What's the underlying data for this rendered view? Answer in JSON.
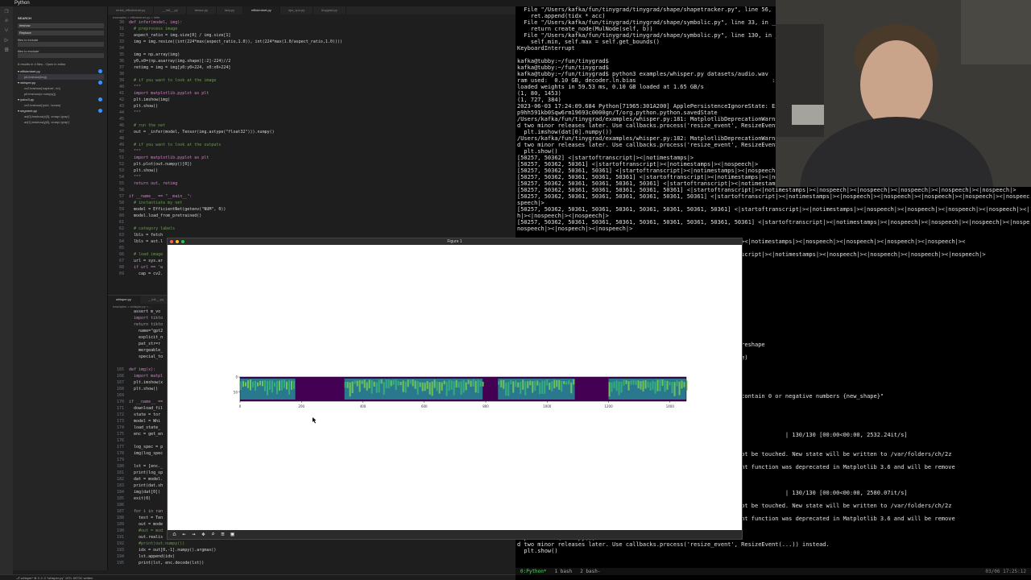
{
  "menubar": {
    "app": "Python"
  },
  "vscode": {
    "sidebar": {
      "title": "SEARCH",
      "search_value": "imshow",
      "replace_placeholder": "Replace",
      "include_label": "files to include",
      "exclude_label": "files to exclude",
      "results_summary": "8 results in 4 files - Open in editor",
      "files": [
        {
          "name": "efficientnet.py",
          "matches": [
            "plt.imshow(img)"
          ]
        },
        {
          "name": "whisper.py",
          "matches": [
            "cv2.imshow('capture', im)",
            "plt.imshow(x.numpy())"
          ]
        },
        {
          "name": "yolov3.py",
          "matches": [
            "cv2.imshow('yolo', boxes)"
          ]
        },
        {
          "name": "segment.py",
          "matches": [
            "ax[0].imshow(x[0], cmap='gray')",
            "ax[1].imshow(y[0], cmap='gray')"
          ]
        }
      ]
    },
    "tabs": [
      "mnist_efficientnet.py",
      "__init__.py",
      "tensor.py",
      "lazy.py",
      "efficientnet.py",
      "ops_cpu.py",
      "tinygrad.py"
    ],
    "active_tab": "efficientnet.py",
    "breadcrumb": "examples > efficientnet.py > infer",
    "code_top": [
      {
        "ln": "30",
        "t": "def infer(model, img):"
      },
      {
        "ln": "31",
        "t": "  # preprocess image"
      },
      {
        "ln": "32",
        "t": "  aspect_ratio = img.size[0] / img.size[1]"
      },
      {
        "ln": "33",
        "t": "  img = img.resize((int(224*max(aspect_ratio,1.0)), int(224*max(1.0/aspect_ratio,1.0))))"
      },
      {
        "ln": "34",
        "t": ""
      },
      {
        "ln": "35",
        "t": "  img = np.array(img)"
      },
      {
        "ln": "36",
        "t": "  y0,x0=(np.asarray(img.shape)[:2]-224)//2"
      },
      {
        "ln": "37",
        "t": "  retimg = img = img[y0:y0+224, x0:x0+224]"
      },
      {
        "ln": "38",
        "t": ""
      },
      {
        "ln": "39",
        "t": "  # if you want to look at the image"
      },
      {
        "ln": "40",
        "t": "  \"\"\""
      },
      {
        "ln": "41",
        "t": "  import matplotlib.pyplot as plt"
      },
      {
        "ln": "42",
        "t": "  plt.imshow(img)"
      },
      {
        "ln": "43",
        "t": "  plt.show()"
      },
      {
        "ln": "44",
        "t": "  \"\"\""
      },
      {
        "ln": "45",
        "t": ""
      },
      {
        "ln": "46",
        "t": "  # run the net"
      },
      {
        "ln": "47",
        "t": "  out = _infer(model, Tensor(img.astype(\"float32\"))).numpy()"
      },
      {
        "ln": "48",
        "t": ""
      },
      {
        "ln": "49",
        "t": "  # if you want to look at the outputs"
      },
      {
        "ln": "50",
        "t": "  \"\"\""
      },
      {
        "ln": "51",
        "t": "  import matplotlib.pyplot as plt"
      },
      {
        "ln": "52",
        "t": "  plt.plot(out.numpy()[0])"
      },
      {
        "ln": "53",
        "t": "  plt.show()"
      },
      {
        "ln": "54",
        "t": "  \"\"\""
      },
      {
        "ln": "55",
        "t": "  return out, retimg"
      },
      {
        "ln": "56",
        "t": ""
      },
      {
        "ln": "57",
        "t": "if __name__ == \"__main__\":"
      },
      {
        "ln": "58",
        "t": "  # instantiate my net"
      },
      {
        "ln": "59",
        "t": "  model = EfficientNet(getenv(\"NUM\", 0))"
      },
      {
        "ln": "60",
        "t": "  model.load_from_pretrained()"
      },
      {
        "ln": "61",
        "t": ""
      },
      {
        "ln": "62",
        "t": "  # category labels"
      },
      {
        "ln": "63",
        "t": "  lbls = fetch"
      },
      {
        "ln": "64",
        "t": "  lbls = ast.l"
      },
      {
        "ln": "65",
        "t": ""
      },
      {
        "ln": "66",
        "t": "  # load image"
      },
      {
        "ln": "67",
        "t": "  url = sys.ar"
      },
      {
        "ln": "68",
        "t": "  if url == 'w"
      },
      {
        "ln": "69",
        "t": "    cap = cv2."
      }
    ],
    "pane2_tabs": [
      "whisper.py",
      "__init__.py"
    ],
    "pane2_breadcrumb": "examples > whisper.py > ...",
    "code_bottom": [
      {
        "ln": "",
        "t": "  assert m_vo"
      },
      {
        "ln": "",
        "t": "  import tikto"
      },
      {
        "ln": "",
        "t": "  return tikto"
      },
      {
        "ln": "",
        "t": "    name=\"gpt2"
      },
      {
        "ln": "",
        "t": "    explicit_n"
      },
      {
        "ln": "",
        "t": "    pat_str=r"
      },
      {
        "ln": "",
        "t": "    mergeable_"
      },
      {
        "ln": "",
        "t": "    special_to"
      },
      {
        "ln": "",
        "t": ""
      },
      {
        "ln": "165",
        "t": "def img(x):"
      },
      {
        "ln": "166",
        "t": "  import matpl"
      },
      {
        "ln": "167",
        "t": "  plt.imshow(x"
      },
      {
        "ln": "168",
        "t": "  plt.show()"
      },
      {
        "ln": "169",
        "t": ""
      },
      {
        "ln": "170",
        "t": "if __name__ =="
      },
      {
        "ln": "171",
        "t": "  download_fil"
      },
      {
        "ln": "172",
        "t": "  state = tor"
      },
      {
        "ln": "173",
        "t": "  model = Whi"
      },
      {
        "ln": "174",
        "t": "  load_state_"
      },
      {
        "ln": "175",
        "t": "  enc = get_en"
      },
      {
        "ln": "176",
        "t": ""
      },
      {
        "ln": "177",
        "t": "  log_spec = p"
      },
      {
        "ln": "178",
        "t": "  img(log_spec"
      },
      {
        "ln": "179",
        "t": ""
      },
      {
        "ln": "180",
        "t": "  lst = [enc._"
      },
      {
        "ln": "181",
        "t": "  print(log_sp"
      },
      {
        "ln": "182",
        "t": "  dat = model."
      },
      {
        "ln": "183",
        "t": "  print(dat.sh"
      },
      {
        "ln": "184",
        "t": "  img(dat[0])"
      },
      {
        "ln": "185",
        "t": "  exit(0)"
      },
      {
        "ln": "186",
        "t": ""
      },
      {
        "ln": "187",
        "t": "  for i in ran"
      },
      {
        "ln": "188",
        "t": "    test = Ten"
      },
      {
        "ln": "189",
        "t": "    out = mode"
      },
      {
        "ln": "190",
        "t": "    #out = mod"
      },
      {
        "ln": "191",
        "t": "    out.realis"
      },
      {
        "ln": "192",
        "t": "    #print(out.numpy())"
      },
      {
        "ln": "193",
        "t": "    idx = out[0,-1].numpy().argmax()"
      },
      {
        "ln": "194",
        "t": "    lst.append(idx)"
      },
      {
        "ln": "195",
        "t": "    print(lst, enc.decode(lst))"
      }
    ],
    "status": "⎇ whisper*   ⊗ 0 ⚠ 0   \"whisper.py\" 197L 6973C written"
  },
  "terminal": {
    "lines": [
      "  File \"/Users/kafka/fun/tinygrad/tinygrad/shape/shapetracker.py\", line 56, in i",
      "    ret.append(tidx * acc)",
      "  File \"/Users/kafka/fun/tinygrad/tinygrad/shape/symbolic.py\", line 33, in __mul_",
      "    return create_node(MulNode(self, b))",
      "  File \"/Users/kafka/fun/tinygrad/tinygrad/shape/symbolic.py\", line 130, in __init",
      "    self.min, self.max = self.get_bounds()",
      "KeyboardInterrupt",
      "",
      "kafka@tubby:~/fun/tinygrad$",
      "kafka@tubby:~/fun/tinygrad$",
      "kafka@tubby:~/fun/tinygrad$ python3 examples/whisper.py datasets/audio.wav",
      "ram used:  0.10 GB, decoder.ln.bias                                        : 100%|",
      "loaded weights in 59.53 ms, 0.10 GB loaded at 1.65 GB/s",
      "(1, 80, 1453)",
      "(1, 727, 384)",
      "2023-06-03 17:24:09.684 Python[71965:301A200] ApplePersistenceIgnoreState: Existi",
      "p9hh591kb0Sqw6rm19693c0000gn/T/org.python.python.savedState",
      "/Users/kafka/fun/tinygrad/examples/whisper.py:181: MatplotlibDeprecationWarning:",
      "d two minor releases later. Use callbacks.process('resize_event', ResizeEvent(...",
      "  plt.imshow(dat[0].numpy())",
      "/Users/kafka/fun/tinygrad/examples/whisper.py:182: MatplotlibDeprecationWarning: The resize_event function was deprecated in Matplotlib 3.6 and will be remove",
      "d two minor releases later. Use callbacks.process('resize_event', ResizeEvent(...)) instead.",
      "  plt.show()",
      "[50257, 50362] <|startoftranscript|><|notimestamps|>",
      "[50257, 50362, 50361] <|startoftranscript|><|notimestamps|><|nospeech|>",
      "[50257, 50362, 50361, 50361] <|startoftranscript|><|notimestamps|><|nospeech|><|nospeech|>",
      "[50257, 50362, 50361, 50361, 50361] <|startoftranscript|><|notimestamps|><|nospeech|><|nospeech|><|nospeech|>",
      "[50257, 50362, 50361, 50361, 50361, 50361] <|startoftranscript|><|notimestamps|><|nospeech|><|nospeech|><|nospeech|><|nospeech|>",
      "[50257, 50362, 50361, 50361, 50361, 50361, 50361] <|startoftranscript|><|notimestamps|><|nospeech|><|nospeech|><|nospeech|><|nospeech|><|nospeech|>",
      "[50257, 50362, 50361, 50361, 50361, 50361, 50361, 50361] <|startoftranscript|><|notimestamps|><|nospeech|><|nospeech|><|nospeech|><|nospeech|><|nospeech|><|no",
      "speech|>",
      "[50257, 50362, 50361, 50361, 50361, 50361, 50361, 50361, 50361] <|startoftranscript|><|notimestamps|><|nospeech|><|nospeech|><|nospeech|><|nospeech|><|nospeec",
      "h|><|nospeech|><|nospeech|>",
      "[50257, 50362, 50361, 50361, 50361, 50361, 50361, 50361, 50361, 50361] <|startoftranscript|><|notimestamps|><|nospeech|><|nospeech|><|nospeech|><|nospeech|><",
      "nospeech|><|nospeech|><|nospeech|>",
      "",
      "                                        5361] <|startoftranscript|><|notimestamps|><|nospeech|><|nospeech|><|nospeech|><|nospeech|><",
      "",
      "                                        5361, 50361] <|startoftranscript|><|notimestamps|><|nospeech|><|nospeech|><|nospeech|><|nospeech|>",
      "                                        <|nospeech|>",
      "",
      "",
      "                                        module>",
      "",
      "                                        ize",
      "",
      "                                        ize",
      "",
      "                                        ize",
      "",
      "                                        ize",
      "",
      "                                        ISSUE: this can include a reshape",
      "                                        binaryops",
      "                                        RESHAPE, intermediate_shape)",
      "                                        ent_op",
      "",
      "                                        e 232, in movement_op",
      "",
      "                                        e 187, in reshape",
      "                                        es must be ints and can't contain 0 or negative numbers {new_shape}\"",
      "",
      "",
      "",
      "",
      "                                        wav",
      "                                        100%|                                  | 130/130 [00:00<00:00, 2532.24it/s]",
      "",
      "",
      "                                        ate: Existing state will not be touched. New state will be written to /var/folders/ch/2z",
      "",
      "                                        ionWarning: The resize_event function was deprecated in Matplotlib 3.6 and will be remove",
      "                                        zeEvent(...)) instead.",
      "",
      "                                        wav",
      "                                        100%|                                  | 130/130 [00:00<00:00, 2580.07it/s]",
      "",
      "                                        ate: Existing state will not be touched. New state will be written to /var/folders/ch/2z",
      "",
      "                                        ionWarning: The resize_event function was deprecated in Matplotlib 3.6 and will be remove",
      "                                        zeEvent(...)) instead.",
      "",
      "  plt.imshow(x.numpy())",
      "d two minor releases later. Use callbacks.process('resize_event', ResizeEvent(...)) instead.",
      "  plt.show()",
      ""
    ],
    "tmux_windows": [
      "0:Python*",
      "1 bash",
      "2 bash-"
    ],
    "tmux_right": "03/06  17:25:12"
  },
  "figure": {
    "title": "Figure 1",
    "toolbar_icons": [
      "home-icon",
      "back-icon",
      "forward-icon",
      "pan-icon",
      "zoom-icon",
      "configure-icon",
      "save-icon"
    ]
  },
  "chart_data": {
    "type": "heatmap",
    "title": "",
    "xlabel": "",
    "ylabel": "",
    "xticks": [
      0,
      200,
      400,
      600,
      800,
      1000,
      1200,
      1400
    ],
    "yticks": [
      0,
      50
    ],
    "xlim": [
      0,
      1453
    ],
    "ylim": [
      80,
      0
    ],
    "colormap": "viridis",
    "active_segments": [
      [
        0,
        180
      ],
      [
        340,
        790
      ],
      [
        840,
        1090
      ],
      [
        1200,
        1453
      ]
    ],
    "colors": {
      "background": "#440154",
      "mid": "#2a788e",
      "high": "#7ad151"
    }
  }
}
